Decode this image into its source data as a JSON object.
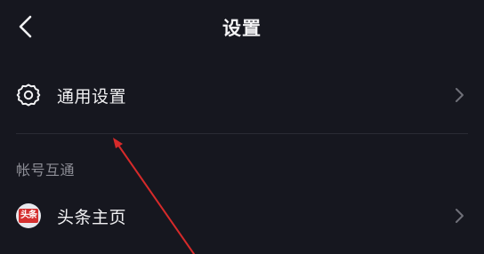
{
  "header": {
    "title": "设置",
    "back_icon": "chevron-left-icon"
  },
  "general_settings": {
    "label": "通用设置",
    "icon": "gear-icon",
    "trailing_icon": "chevron-right-icon"
  },
  "account_linking": {
    "section_title": "帐号互通",
    "items": [
      {
        "label": "头条主页",
        "logo_text": "头条",
        "icon": "toutiao-logo",
        "trailing_icon": "chevron-right-icon"
      }
    ]
  },
  "colors": {
    "background": "#16171f",
    "divider": "#2a2b34",
    "section_text": "#8d8e96",
    "annotation_arrow": "#d62a2a",
    "toutiao_red": "#d5302f"
  }
}
